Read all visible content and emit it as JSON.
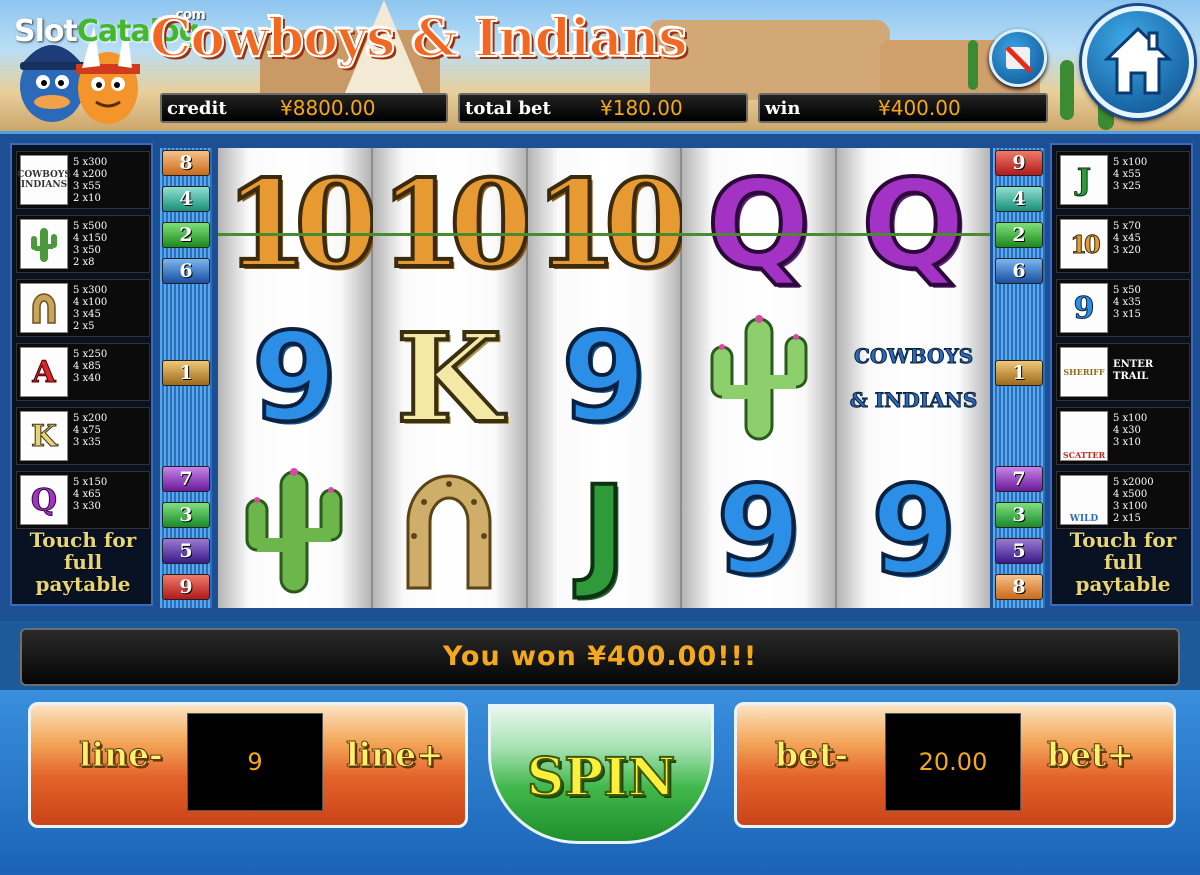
{
  "header": {
    "watermark": {
      "part1": "Slot",
      "part2": "Catalog",
      "suffix": ".com"
    },
    "title": "Cowboys & Indians",
    "credit": {
      "label": "credit",
      "value": "¥8800.00"
    },
    "total_bet": {
      "label": "total bet",
      "value": "¥180.00"
    },
    "win": {
      "label": "win",
      "value": "¥400.00"
    }
  },
  "paytable_left": {
    "rows": [
      {
        "symbol": "COWBOYS INDIANS",
        "pays": "5 x300\n4 x200\n3 x55\n2 x10"
      },
      {
        "symbol": "cactus",
        "pays": "5 x500\n4 x150\n3 x50\n2 x8"
      },
      {
        "symbol": "horseshoe",
        "pays": "5 x300\n4 x100\n3 x45\n2 x5"
      },
      {
        "symbol": "A",
        "pays": "5 x250\n4 x85\n3 x40"
      },
      {
        "symbol": "K",
        "pays": "5 x200\n4 x75\n3 x35"
      },
      {
        "symbol": "Q",
        "pays": "5 x150\n4 x65\n3 x30"
      }
    ],
    "touch_label": "Touch for full paytable"
  },
  "paytable_right": {
    "rows": [
      {
        "symbol": "J",
        "pays": "5 x100\n4 x55\n3 x25"
      },
      {
        "symbol": "10",
        "pays": "5 x70\n4 x45\n3 x20"
      },
      {
        "symbol": "9",
        "pays": "5 x50\n4 x35\n3 x15"
      },
      {
        "symbol": "SHERIFF",
        "pays": "ENTER\nTRAIL"
      },
      {
        "symbol": "SCATTER",
        "pays": "5 x100\n4 x30\n3 x10"
      },
      {
        "symbol": "WILD",
        "pays": "5 x2000\n4 x500\n3 x100\n2 x15"
      }
    ],
    "touch_label": "Touch for full paytable"
  },
  "line_markers_left": {
    "top": [
      "8",
      "4",
      "2",
      "6"
    ],
    "middle": [
      "1"
    ],
    "bottom": [
      "7",
      "3",
      "5",
      "9"
    ]
  },
  "line_markers_right": {
    "top": [
      "9",
      "4",
      "2",
      "6"
    ],
    "middle": [
      "1"
    ],
    "bottom": [
      "7",
      "3",
      "5",
      "8"
    ]
  },
  "reels": [
    [
      "10",
      "9",
      "cactus"
    ],
    [
      "10",
      "K",
      "horseshoe"
    ],
    [
      "10",
      "9",
      "J"
    ],
    [
      "Q",
      "cactus",
      "9"
    ],
    [
      "Q",
      "COWBOYS & INDIANS",
      "9"
    ]
  ],
  "status_message": "You won ¥400.00!!!",
  "controls": {
    "line_minus": "line-",
    "line_value": "9",
    "line_plus": "line+",
    "spin": "SPIN",
    "bet_minus": "bet-",
    "bet_value": "20.00",
    "bet_plus": "bet+"
  }
}
